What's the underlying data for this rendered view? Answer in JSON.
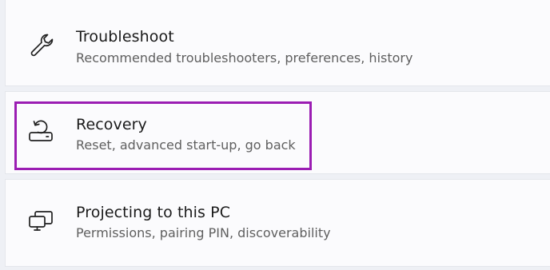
{
  "items": [
    {
      "title": "Troubleshoot",
      "subtitle": "Recommended troubleshooters, preferences, history",
      "icon": "wrench-icon"
    },
    {
      "title": "Recovery",
      "subtitle": "Reset, advanced start-up, go back",
      "icon": "recovery-icon"
    },
    {
      "title": "Projecting to this PC",
      "subtitle": "Permissions, pairing PIN, discoverability",
      "icon": "project-to-pc-icon"
    }
  ],
  "colors": {
    "highlight": "#9b1db3",
    "card_background": "#fbfbfd",
    "page_background": "#eef0f5"
  }
}
